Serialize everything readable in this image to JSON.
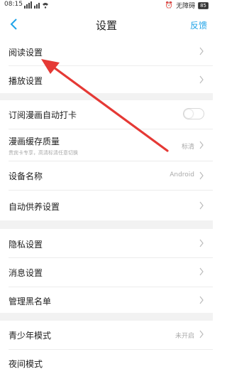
{
  "status_bar": {
    "time": "08:15",
    "network_label": "无障碍",
    "battery": "85"
  },
  "nav": {
    "title": "设置",
    "feedback": "反馈"
  },
  "sections": {
    "reading": "阅读设置",
    "playback": "播放设置",
    "auto_checkin": "订阅漫画自动打卡",
    "auto_checkin_on": false,
    "cache_quality": "漫画缓存质量",
    "cache_quality_sub": "贵宾卡专享，高清标清任意切换",
    "cache_quality_value": "标清",
    "device_name": "设备名称",
    "device_name_value": "Android",
    "auto_feed": "自动供养设置",
    "privacy": "隐私设置",
    "message": "消息设置",
    "blacklist": "管理黑名单",
    "youth_mode": "青少年模式",
    "youth_mode_value": "未开启",
    "night_mode": "夜间模式"
  },
  "colors": {
    "accent": "#1fa3e8",
    "annotation_arrow": "#e53935",
    "section_gap": "#f2f2f2"
  }
}
